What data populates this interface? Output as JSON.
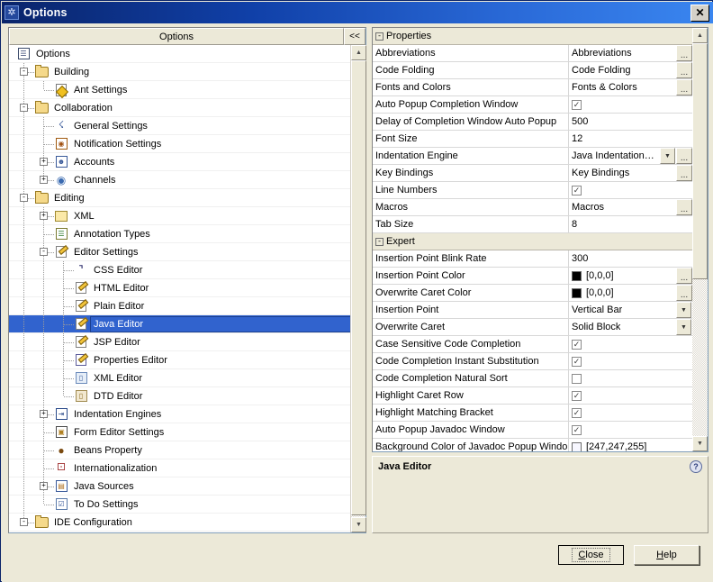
{
  "window": {
    "title": "Options",
    "icon": "options-gear-icon",
    "close_label": "✕"
  },
  "left_pane": {
    "header_label": "Options",
    "collapse_label": "<<",
    "tree": [
      {
        "label": "Options",
        "level": 0,
        "icon": "options-root-icon",
        "toggle": "",
        "selected": false
      },
      {
        "label": "Building",
        "level": 1,
        "icon": "folder-icon",
        "toggle": "-",
        "selected": false
      },
      {
        "label": "Ant Settings",
        "level": 2,
        "icon": "ant-settings-icon",
        "toggle": "",
        "selected": false
      },
      {
        "label": "Collaboration",
        "level": 1,
        "icon": "folder-icon",
        "toggle": "-",
        "selected": false
      },
      {
        "label": "General Settings",
        "level": 2,
        "icon": "general-settings-icon",
        "toggle": "",
        "selected": false
      },
      {
        "label": "Notification Settings",
        "level": 2,
        "icon": "notification-icon",
        "toggle": "",
        "selected": false
      },
      {
        "label": "Accounts",
        "level": 2,
        "icon": "accounts-icon",
        "toggle": "+",
        "selected": false
      },
      {
        "label": "Channels",
        "level": 2,
        "icon": "channels-icon",
        "toggle": "+",
        "selected": false
      },
      {
        "label": "Editing",
        "level": 1,
        "icon": "folder-icon",
        "toggle": "-",
        "selected": false
      },
      {
        "label": "XML",
        "level": 2,
        "icon": "folder-plain-icon",
        "toggle": "+",
        "selected": false
      },
      {
        "label": "Annotation Types",
        "level": 2,
        "icon": "annotation-types-icon",
        "toggle": "",
        "selected": false
      },
      {
        "label": "Editor Settings",
        "level": 2,
        "icon": "editor-settings-icon",
        "toggle": "-",
        "selected": false
      },
      {
        "label": "CSS Editor",
        "level": 3,
        "icon": "css-editor-icon",
        "toggle": "",
        "selected": false
      },
      {
        "label": "HTML Editor",
        "level": 3,
        "icon": "html-editor-icon",
        "toggle": "",
        "selected": false
      },
      {
        "label": "Plain Editor",
        "level": 3,
        "icon": "plain-editor-icon",
        "toggle": "",
        "selected": false
      },
      {
        "label": "Java Editor",
        "level": 3,
        "icon": "java-editor-icon",
        "toggle": "",
        "selected": true
      },
      {
        "label": "JSP Editor",
        "level": 3,
        "icon": "jsp-editor-icon",
        "toggle": "",
        "selected": false
      },
      {
        "label": "Properties Editor",
        "level": 3,
        "icon": "properties-editor-icon",
        "toggle": "",
        "selected": false
      },
      {
        "label": "XML Editor",
        "level": 3,
        "icon": "xml-editor-icon",
        "toggle": "",
        "selected": false
      },
      {
        "label": "DTD Editor",
        "level": 3,
        "icon": "dtd-editor-icon",
        "toggle": "",
        "selected": false
      },
      {
        "label": "Indentation Engines",
        "level": 2,
        "icon": "indentation-engines-icon",
        "toggle": "+",
        "selected": false
      },
      {
        "label": "Form Editor Settings",
        "level": 2,
        "icon": "form-editor-icon",
        "toggle": "",
        "selected": false
      },
      {
        "label": "Beans Property",
        "level": 2,
        "icon": "beans-property-icon",
        "toggle": "",
        "selected": false
      },
      {
        "label": "Internationalization",
        "level": 2,
        "icon": "internationalization-icon",
        "toggle": "",
        "selected": false
      },
      {
        "label": "Java Sources",
        "level": 2,
        "icon": "java-sources-icon",
        "toggle": "+",
        "selected": false
      },
      {
        "label": "To Do Settings",
        "level": 2,
        "icon": "todo-settings-icon",
        "toggle": "",
        "selected": false
      },
      {
        "label": "IDE Configuration",
        "level": 1,
        "icon": "folder-icon",
        "toggle": "-",
        "selected": false
      }
    ]
  },
  "properties": {
    "rows": [
      {
        "kind": "group",
        "toggle": "-",
        "name": "Properties"
      },
      {
        "kind": "text",
        "name": "Abbreviations",
        "value": "Abbreviations",
        "ellipsis": true
      },
      {
        "kind": "text",
        "name": "Code Folding",
        "value": "Code Folding",
        "ellipsis": true
      },
      {
        "kind": "text",
        "name": "Fonts and Colors",
        "value": "Fonts & Colors",
        "ellipsis": true
      },
      {
        "kind": "checkbox",
        "name": "Auto Popup Completion Window",
        "checked": true
      },
      {
        "kind": "text",
        "name": "Delay of Completion Window Auto Popup",
        "value": "500"
      },
      {
        "kind": "text",
        "name": "Font Size",
        "value": "12"
      },
      {
        "kind": "combo",
        "name": "Indentation Engine",
        "value": "Java Indentation En...",
        "ellipsis": true
      },
      {
        "kind": "text",
        "name": "Key Bindings",
        "value": "Key Bindings",
        "ellipsis": true
      },
      {
        "kind": "checkbox",
        "name": "Line Numbers",
        "checked": true
      },
      {
        "kind": "text",
        "name": "Macros",
        "value": "Macros",
        "ellipsis": true
      },
      {
        "kind": "text",
        "name": "Tab Size",
        "value": "8"
      },
      {
        "kind": "group",
        "toggle": "-",
        "name": "Expert"
      },
      {
        "kind": "text",
        "name": "Insertion Point Blink Rate",
        "value": "300"
      },
      {
        "kind": "color",
        "name": "Insertion Point Color",
        "value": "[0,0,0]",
        "swatch": "#000000",
        "ellipsis": true
      },
      {
        "kind": "color",
        "name": "Overwrite Caret Color",
        "value": "[0,0,0]",
        "swatch": "#000000",
        "ellipsis": true
      },
      {
        "kind": "combo",
        "name": "Insertion Point",
        "value": "Vertical Bar"
      },
      {
        "kind": "combo",
        "name": "Overwrite Caret",
        "value": "Solid Block"
      },
      {
        "kind": "checkbox",
        "name": "Case Sensitive Code Completion",
        "checked": true
      },
      {
        "kind": "checkbox",
        "name": "Code Completion Instant Substitution",
        "checked": true
      },
      {
        "kind": "checkbox",
        "name": "Code Completion Natural Sort",
        "checked": false
      },
      {
        "kind": "checkbox",
        "name": "Highlight Caret Row",
        "checked": true
      },
      {
        "kind": "checkbox",
        "name": "Highlight Matching Bracket",
        "checked": true
      },
      {
        "kind": "checkbox",
        "name": "Auto Popup Javadoc Window",
        "checked": true
      },
      {
        "kind": "color",
        "name": "Background Color of Javadoc Popup Windo",
        "value": "[247,247,255]",
        "swatch": "#f7f7ff"
      }
    ]
  },
  "description": {
    "title": "Java Editor",
    "help_icon": "question-mark-icon",
    "help_glyph": "?"
  },
  "buttons": {
    "close": {
      "label": "Close",
      "mnemonic": "C"
    },
    "help": {
      "label": "Help",
      "mnemonic": "H"
    }
  },
  "scrollbars": {
    "up_glyph": "▲",
    "down_glyph": "▼"
  }
}
